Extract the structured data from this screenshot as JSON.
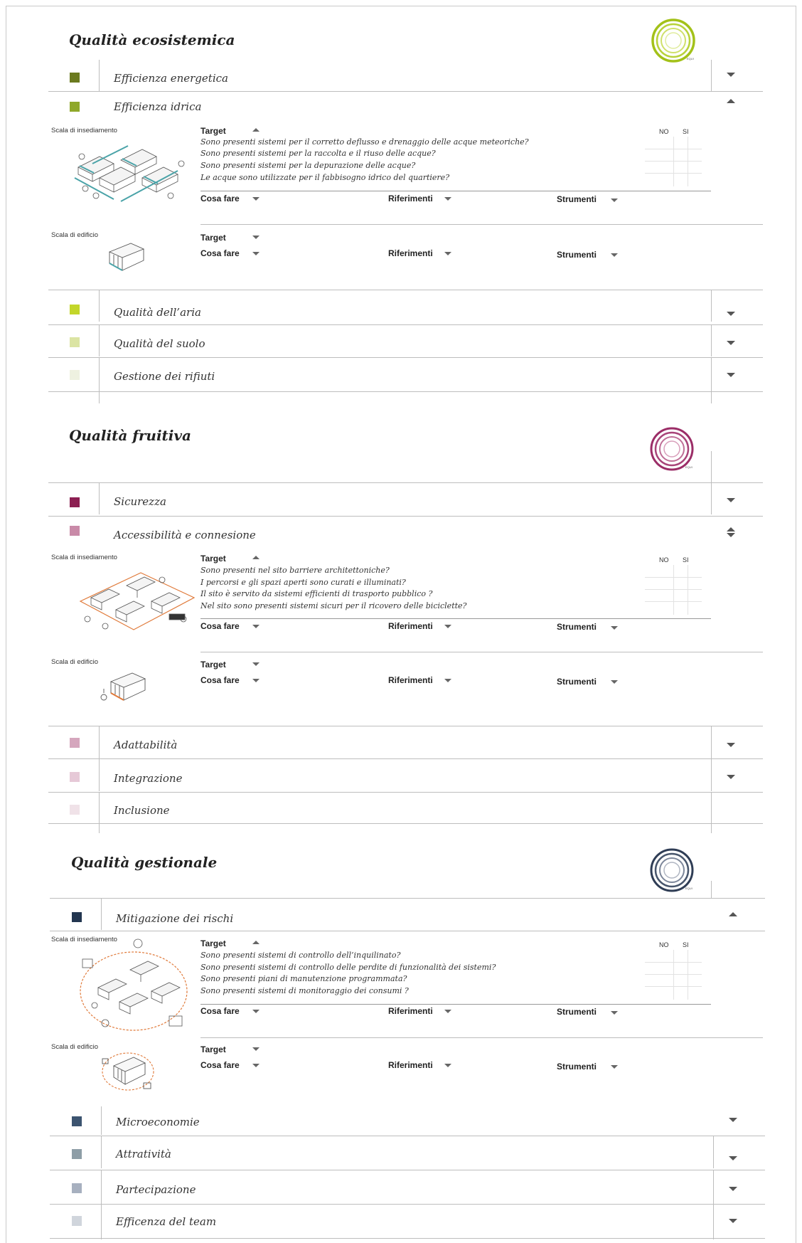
{
  "sections": [
    {
      "title": "Qualità ecosistemica",
      "ring_color": "#a3c119",
      "items": [
        {
          "label": "Efficienza energetica",
          "color": "#6b7a1f",
          "arrow": "down"
        },
        {
          "label": "Efficienza idrica",
          "color": "#8fa82a",
          "arrow": "up",
          "expanded": true,
          "insediamento": {
            "scale_label": "Scala di insediamento",
            "target_label": "Target",
            "questions": [
              "Sono presenti  sistemi per il corretto deflusso e drenaggio delle acque meteoriche?",
              "Sono presenti  sistemi per la raccolta e il riuso delle acque?",
              "Sono presenti  sistemi per la depurazione  delle acque?",
              "Le acque sono utilizzate per il fabbisogno idrico del quartiere?"
            ],
            "no_label": "NO",
            "si_label": "SI",
            "cosa_fare": "Cosa fare",
            "riferimenti": "Riferimenti",
            "strumenti": "Strumenti"
          },
          "edificio": {
            "scale_label": "Scala di edificio",
            "target_label": "Target",
            "cosa_fare": "Cosa fare",
            "riferimenti": "Riferimenti",
            "strumenti": "Strumenti"
          }
        },
        {
          "label": "Qualità dell’aria",
          "color": "#c3d62a",
          "arrow": "down"
        },
        {
          "label": "Qualità del suolo",
          "color": "#dbe4a3",
          "arrow": "down"
        },
        {
          "label": "Gestione dei rifiuti",
          "color": "#eef1e0",
          "arrow": "down"
        }
      ]
    },
    {
      "title": "Qualità fruitiva",
      "ring_color": "#9b2d67",
      "items": [
        {
          "label": "Sicurezza",
          "color": "#8c1f52",
          "arrow": "down"
        },
        {
          "label": "Accessibilità e connesione",
          "color": "#c98aa8",
          "arrow": "updown",
          "expanded": true,
          "insediamento": {
            "scale_label": "Scala di insediamento",
            "target_label": "Target",
            "questions": [
              "Sono presenti nel sito barriere architettoniche?",
              "I percorsi e gli spazi aperti sono curati e illuminati?",
              "Il sito è servito da sistemi efficienti di trasporto pubblico ?",
              "Nel sito sono presenti sistemi sicuri per il ricovero delle biciclette?"
            ],
            "no_label": "NO",
            "si_label": "SI",
            "cosa_fare": "Cosa fare",
            "riferimenti": "Riferimenti",
            "strumenti": "Strumenti"
          },
          "edificio": {
            "scale_label": "Scala di edificio",
            "target_label": "Target",
            "cosa_fare": "Cosa fare",
            "riferimenti": "Riferimenti",
            "strumenti": "Strumenti"
          }
        },
        {
          "label": "Adattabilità",
          "color": "#d5a6bd",
          "arrow": "down"
        },
        {
          "label": "Integrazione",
          "color": "#e6c9d7",
          "arrow": "down"
        },
        {
          "label": "Inclusione",
          "color": "#f0e2e8",
          "arrow": "none"
        }
      ]
    },
    {
      "title": "Qualità gestionale",
      "ring_color": "#2f3d55",
      "items": [
        {
          "label": "Mitigazione dei rischi",
          "color": "#233650",
          "arrow": "up",
          "expanded": true,
          "insediamento": {
            "scale_label": "Scala di insediamento",
            "target_label": "Target",
            "questions": [
              "Sono presenti sistemi di controllo dell’inquilinato?",
              "Sono presenti  sistemi di controllo delle perdite di funzionalità dei sistemi?",
              "Sono presenti piani di manutenzione programmata?",
              "Sono presenti sistemi di monitoraggio dei consumi ?"
            ],
            "no_label": "NO",
            "si_label": "SI",
            "cosa_fare": "Cosa fare",
            "riferimenti": "Riferimenti",
            "strumenti": "Strumenti"
          },
          "edificio": {
            "scale_label": "Scala di edificio",
            "target_label": "Target",
            "cosa_fare": "Cosa fare",
            "riferimenti": "Riferimenti",
            "strumenti": "Strumenti"
          }
        },
        {
          "label": "Microeconomie",
          "color": "#3c5470",
          "arrow": "down"
        },
        {
          "label": "Attratività",
          "color": "#8e9ea7",
          "arrow": "down"
        },
        {
          "label": "Partecipazione",
          "color": "#a7b0bf",
          "arrow": "down"
        },
        {
          "label": "Efficenza del team",
          "color": "#d0d5dc",
          "arrow": "down"
        }
      ]
    }
  ]
}
